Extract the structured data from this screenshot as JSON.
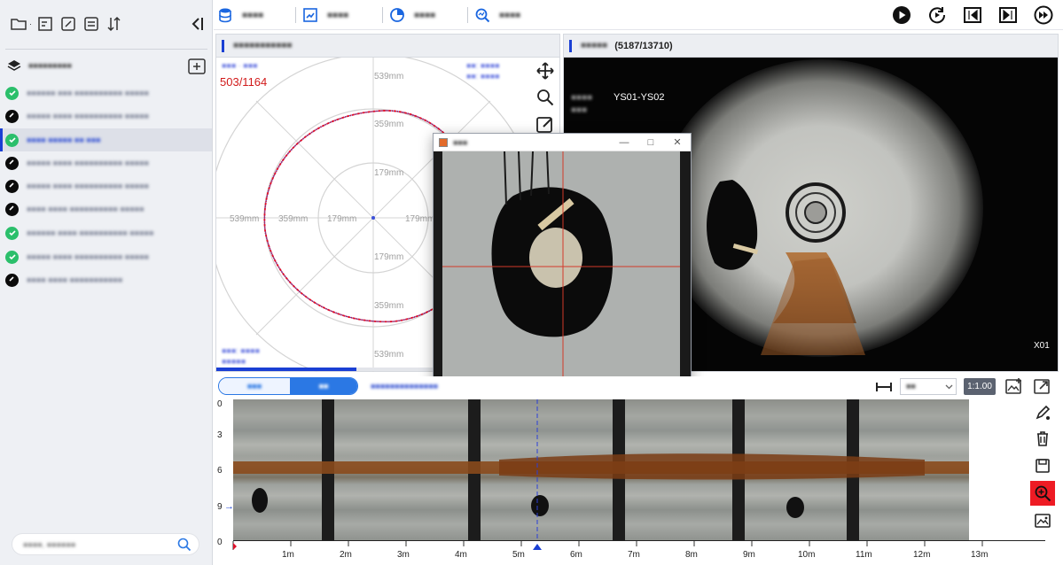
{
  "polar": {
    "frame_counter": "503/1164",
    "rings": [
      "539mm",
      "359mm",
      "179mm"
    ],
    "axis_labels_left": [
      "539mm",
      "359mm",
      "179mm"
    ],
    "axis_labels_right": [
      "179mm"
    ]
  },
  "camera": {
    "frame_info": "(5187/13710)",
    "overlay_label": "YS01-YS02",
    "corner_label": "X01"
  },
  "strip": {
    "zoom_ratio": "1:1.00",
    "y_ticks": [
      "0",
      "3",
      "6",
      "9",
      "0"
    ],
    "x_ticks": [
      "1m",
      "2m",
      "3m",
      "4m",
      "5m",
      "6m",
      "7m",
      "8m",
      "9m",
      "10m",
      "11m",
      "12m",
      "13m"
    ]
  },
  "colors": {
    "accent": "#1a3fd4",
    "ok_status": "#2bbf6b",
    "trace_red": "#e0102a",
    "active_tool": "#ee1b24",
    "frame_counter": "#d11a1a"
  },
  "sidebar": {
    "items": [
      {
        "status": "ok"
      },
      {
        "status": "tag"
      },
      {
        "status": "ok",
        "selected": true
      },
      {
        "status": "tag"
      },
      {
        "status": "tag"
      },
      {
        "status": "tag"
      },
      {
        "status": "ok"
      },
      {
        "status": "ok"
      },
      {
        "status": "tag"
      }
    ]
  }
}
